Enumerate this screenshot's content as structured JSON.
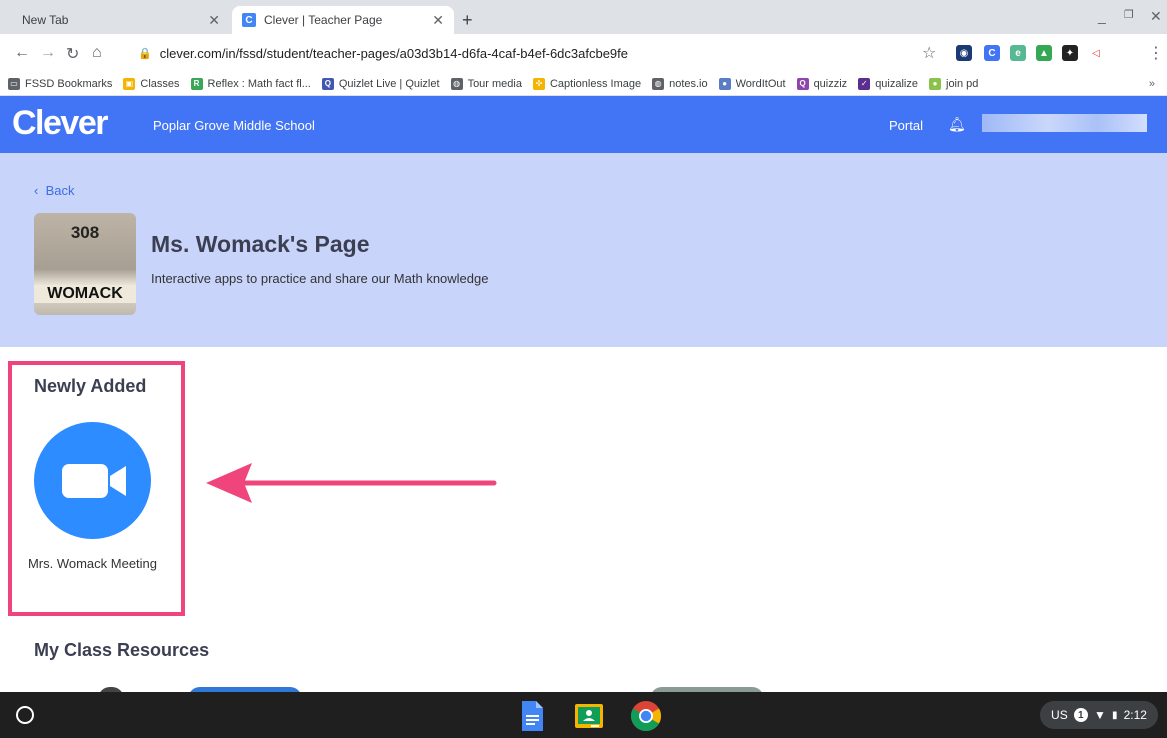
{
  "browser": {
    "tabs": [
      {
        "title": "New Tab",
        "active": false
      },
      {
        "title": "Clever | Teacher Page",
        "active": true,
        "favicon": "C"
      }
    ],
    "url": "clever.com/in/fssd/student/teacher-pages/a03d3b14-d6fa-4caf-b4ef-6dc3afcbe9fe",
    "bookmarks": [
      {
        "label": "FSSD Bookmarks",
        "icon": "folder-icon",
        "color": "#5f6368"
      },
      {
        "label": "Classes",
        "icon": "classroom-icon",
        "color": "#f4b400"
      },
      {
        "label": "Reflex : Math fact fl...",
        "icon": "reflex-icon",
        "color": "#3aa757"
      },
      {
        "label": "Quizlet Live | Quizlet",
        "icon": "quizlet-icon",
        "color": "#4257b2"
      },
      {
        "label": "Tour media",
        "icon": "globe-icon",
        "color": "#5f6368"
      },
      {
        "label": "Captionless Image",
        "icon": "pinwheel-icon",
        "color": "#f4b400"
      },
      {
        "label": "notes.io",
        "icon": "globe-icon",
        "color": "#5f6368"
      },
      {
        "label": "WordItOut",
        "icon": "wordle-icon",
        "color": "#5b7cc7"
      },
      {
        "label": "quizziz",
        "icon": "quizizz-icon",
        "color": "#8e44ad"
      },
      {
        "label": "quizalize",
        "icon": "checkmark-icon",
        "color": "#5c2d91"
      },
      {
        "label": "join pd",
        "icon": "pear-icon",
        "color": "#8bc34a"
      }
    ],
    "bookmarks_more": "»"
  },
  "clever": {
    "logo": "Clever",
    "school": "Poplar Grove Middle School",
    "portal": "Portal"
  },
  "teacher": {
    "back_label": "Back",
    "title": "Ms. Womack's Page",
    "subtitle": "Interactive apps to practice and share our Math knowledge",
    "photo_number": "308",
    "photo_name": "WOMACK"
  },
  "sections": {
    "newly_added": "Newly Added",
    "class_resources": "My Class Resources"
  },
  "apps": [
    {
      "label": "Mrs. Womack Meeting",
      "icon": "zoom-video-icon",
      "color": "#2d8cff"
    }
  ],
  "tray": {
    "locale": "US",
    "notifications": "1",
    "time": "2:12"
  }
}
